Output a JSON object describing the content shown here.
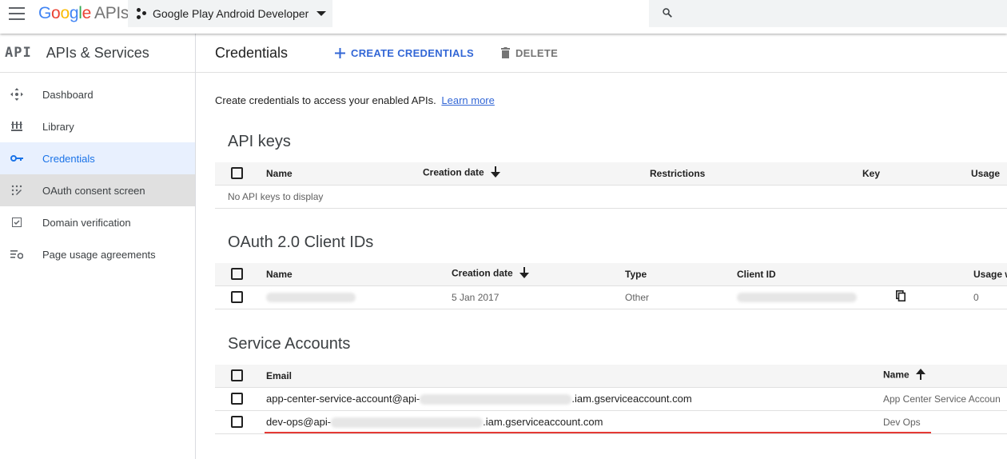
{
  "header": {
    "logo_google": [
      "G",
      "o",
      "o",
      "g",
      "l",
      "e"
    ],
    "logo_apis": "APIs",
    "project_name": "Google Play Android Developer",
    "search_placeholder": ""
  },
  "sidebar": {
    "badge": "API",
    "title": "APIs & Services",
    "items": [
      {
        "label": "Dashboard",
        "icon": "dashboard-icon"
      },
      {
        "label": "Library",
        "icon": "library-icon"
      },
      {
        "label": "Credentials",
        "icon": "key-icon",
        "active": true
      },
      {
        "label": "OAuth consent screen",
        "icon": "oauth-consent-icon"
      },
      {
        "label": "Domain verification",
        "icon": "checkbox-icon"
      },
      {
        "label": "Page usage agreements",
        "icon": "settings-list-icon"
      }
    ]
  },
  "main": {
    "title": "Credentials",
    "create_label": "CREATE CREDENTIALS",
    "delete_label": "DELETE",
    "intro_text": "Create credentials to access your enabled APIs.",
    "learn_more": "Learn more"
  },
  "api_keys": {
    "title": "API keys",
    "columns": [
      "Name",
      "Creation date",
      "Restrictions",
      "Key",
      "Usage"
    ],
    "empty_text": "No API keys to display"
  },
  "oauth": {
    "title": "OAuth 2.0 Client IDs",
    "columns": [
      "Name",
      "Creation date",
      "Type",
      "Client ID",
      "Usage w"
    ],
    "rows": [
      {
        "name": "",
        "date": "5 Jan 2017",
        "type": "Other",
        "client_id": "",
        "usage": "0"
      }
    ]
  },
  "service_accounts": {
    "title": "Service Accounts",
    "columns": [
      "Email",
      "Name"
    ],
    "rows": [
      {
        "email_prefix": "app-center-service-account@api-",
        "email_suffix": ".iam.gserviceaccount.com",
        "name": "App Center Service Accoun"
      },
      {
        "email_prefix": "dev-ops@api-",
        "email_suffix": ".iam.gserviceaccount.com",
        "name": "Dev Ops"
      }
    ]
  },
  "colors": {
    "accent": "#3367d6",
    "active_bg": "#e8f0fe",
    "highlight_underline": "#e53935"
  }
}
